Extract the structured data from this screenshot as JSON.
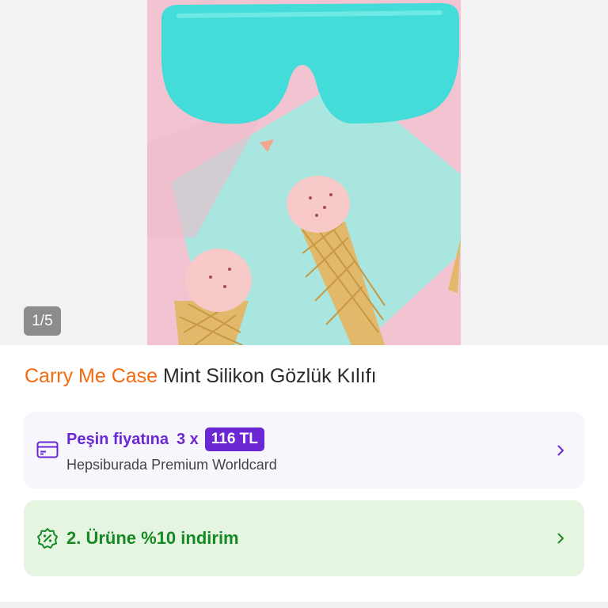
{
  "gallery": {
    "counter": "1/5",
    "image_description_icon": "product-photo"
  },
  "product": {
    "brand": "Carry Me Case",
    "name": "Mint Silikon Gözlük Kılıfı"
  },
  "installment": {
    "label": "Peşin fiyatına",
    "times": "3 x",
    "price": "116 TL",
    "card_name": "Hepsiburada Premium Worldcard",
    "icon": "credit-card-icon",
    "accent": "#6a27d3"
  },
  "campaign": {
    "label": "2. Ürüne %10 indirim",
    "icon": "discount-badge-icon",
    "accent": "#158a24"
  }
}
